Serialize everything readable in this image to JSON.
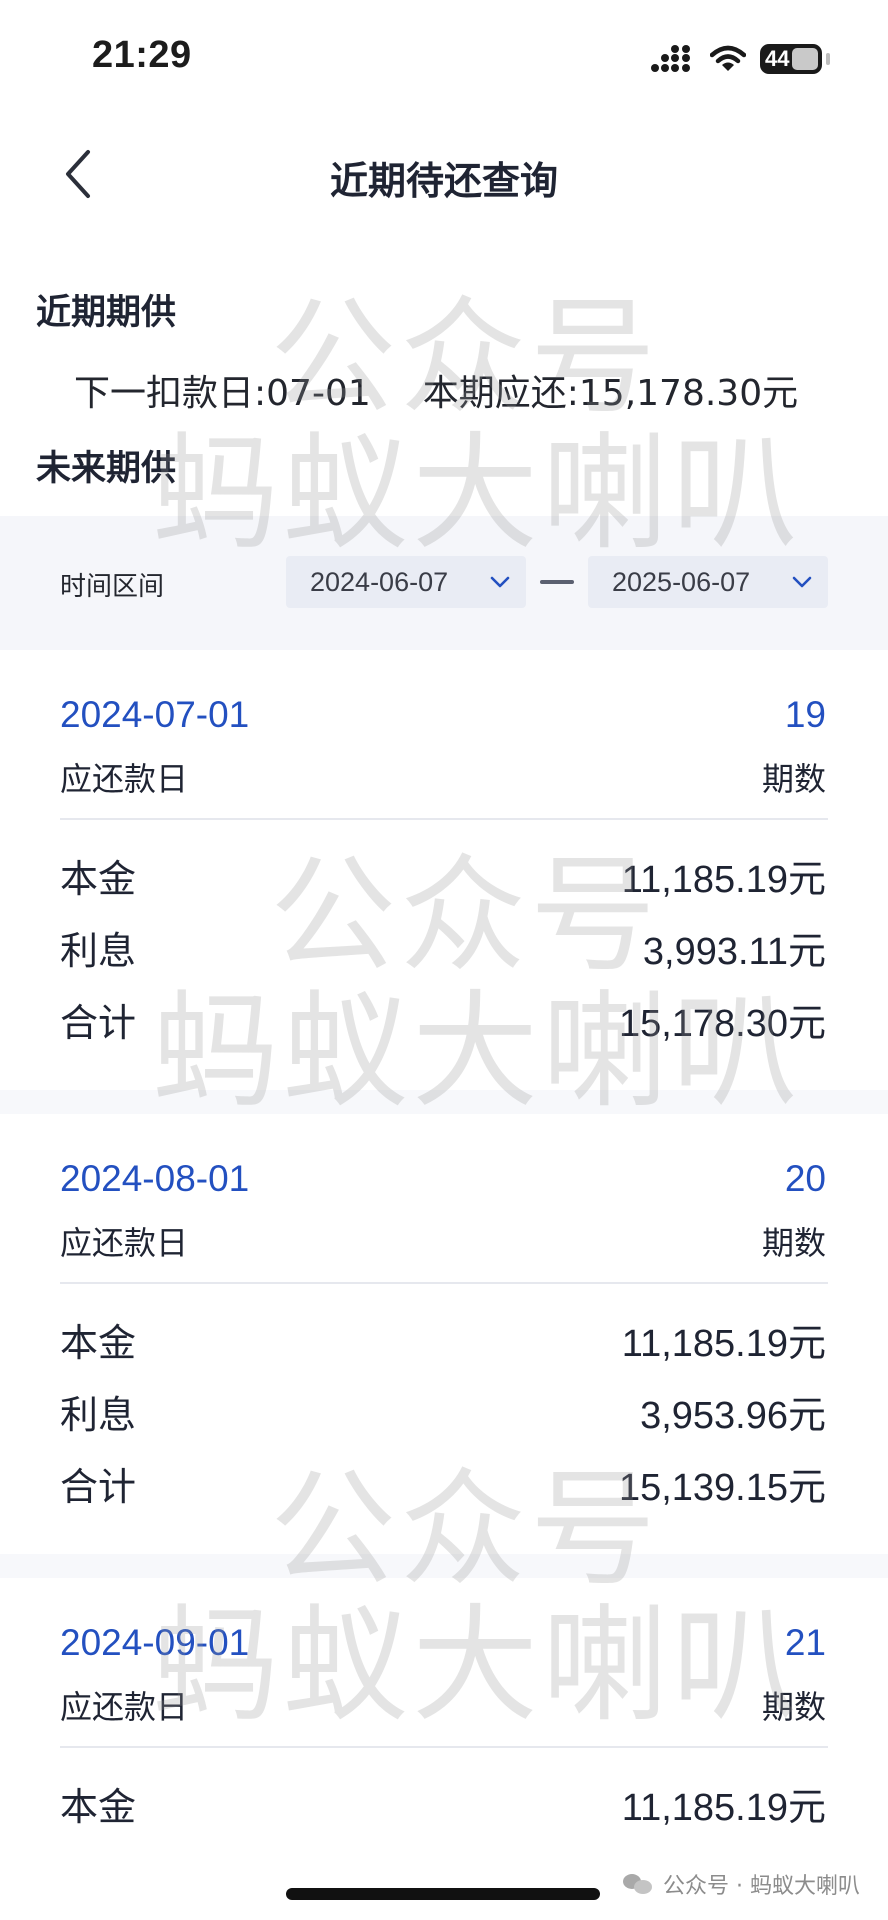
{
  "status_bar": {
    "time": "21:29",
    "battery": "44",
    "icons": [
      "signal-icon",
      "wifi-icon",
      "battery-icon"
    ]
  },
  "nav": {
    "title": "近期待还查询",
    "back_icon": "chevron-left-icon"
  },
  "recent": {
    "section_title": "近期期供",
    "next_debit_label": "下一扣款日:",
    "next_debit_value": "07-01",
    "current_due_label": "本期应还:",
    "current_due_value": "15,178.30元"
  },
  "future": {
    "section_title": "未来期供",
    "filter_label": "时间区间",
    "start_date": "2024-06-07",
    "end_date": "2025-06-07"
  },
  "labels": {
    "due_date": "应还款日",
    "period": "期数",
    "principal": "本金",
    "interest": "利息",
    "total": "合计"
  },
  "cards": [
    {
      "date": "2024-07-01",
      "period": "19",
      "principal": "11,185.19元",
      "interest": "3,993.11元",
      "total": "15,178.30元"
    },
    {
      "date": "2024-08-01",
      "period": "20",
      "principal": "11,185.19元",
      "interest": "3,953.96元",
      "total": "15,139.15元"
    },
    {
      "date": "2024-09-01",
      "period": "21",
      "principal": "11,185.19元"
    }
  ],
  "watermark": {
    "line1": "公众号",
    "line2": "蚂蚁大喇叭"
  },
  "footer": {
    "brand": "公众号 · 蚂蚁大喇叭"
  },
  "colors": {
    "accent": "#2350c0",
    "text": "#1f2433",
    "filter_bg": "#f5f6fa",
    "select_bg": "#e9ecf4"
  }
}
